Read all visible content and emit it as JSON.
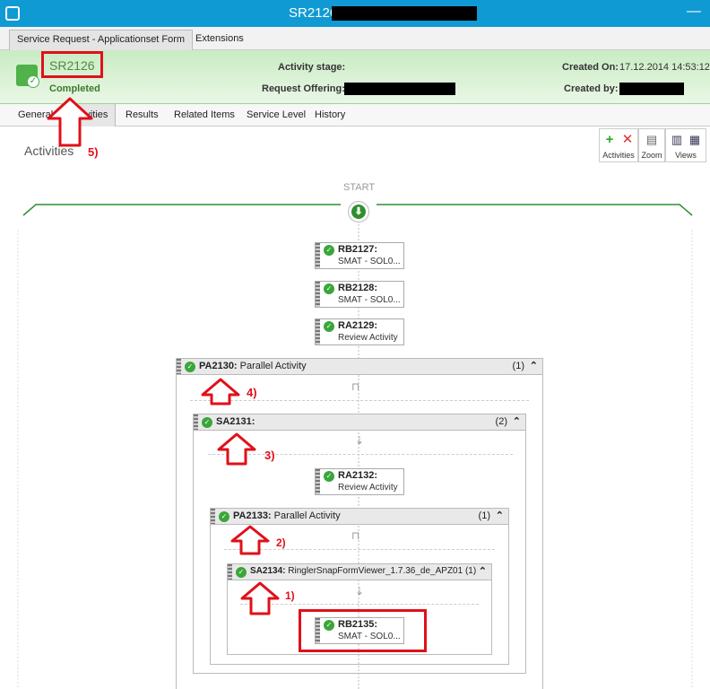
{
  "window": {
    "title": "SR2126 :",
    "minimize": "—"
  },
  "form_tabs": [
    "Service Request - Applicationset Form",
    "Extensions"
  ],
  "header": {
    "id": "SR2126",
    "status": "Completed",
    "activity_stage_label": "Activity stage:",
    "request_offering_label": "Request Offering:",
    "created_on_label": "Created On:",
    "created_on_value": "17.12.2014 14:53:12",
    "created_by_label": "Created by:"
  },
  "sub_tabs": [
    "General",
    "Activities",
    "Results",
    "Related Items",
    "Service Level",
    "History"
  ],
  "activities_heading": "Activities",
  "toolbar": {
    "group1_label": "Activities",
    "group2_label": "Zoom",
    "group3_label": "Views"
  },
  "start_label": "START",
  "cards": {
    "rb2127": {
      "id": "RB2127:",
      "desc": "SMAT - SOL0..."
    },
    "rb2128": {
      "id": "RB2128:",
      "desc": "SMAT - SOL0..."
    },
    "ra2129": {
      "id": "RA2129:",
      "desc": "Review Activity"
    },
    "ra2132": {
      "id": "RA2132:",
      "desc": "Review Activity"
    },
    "rb2135": {
      "id": "RB2135:",
      "desc": "SMAT - SOL0..."
    }
  },
  "containers": {
    "pa2130": {
      "id": "PA2130:",
      "title": "Parallel Activity",
      "count": "(1)"
    },
    "sa2131": {
      "id": "SA2131:",
      "title": "",
      "count": "(2)"
    },
    "pa2133": {
      "id": "PA2133:",
      "title": "Parallel Activity",
      "count": "(1)"
    },
    "sa2134": {
      "id": "SA2134:",
      "title": "RinglerSnapFormViewer_1.7.36_de_APZ01",
      "count": "(1)"
    }
  },
  "annotations": [
    "1)",
    "2)",
    "3)",
    "4)",
    "5)"
  ]
}
